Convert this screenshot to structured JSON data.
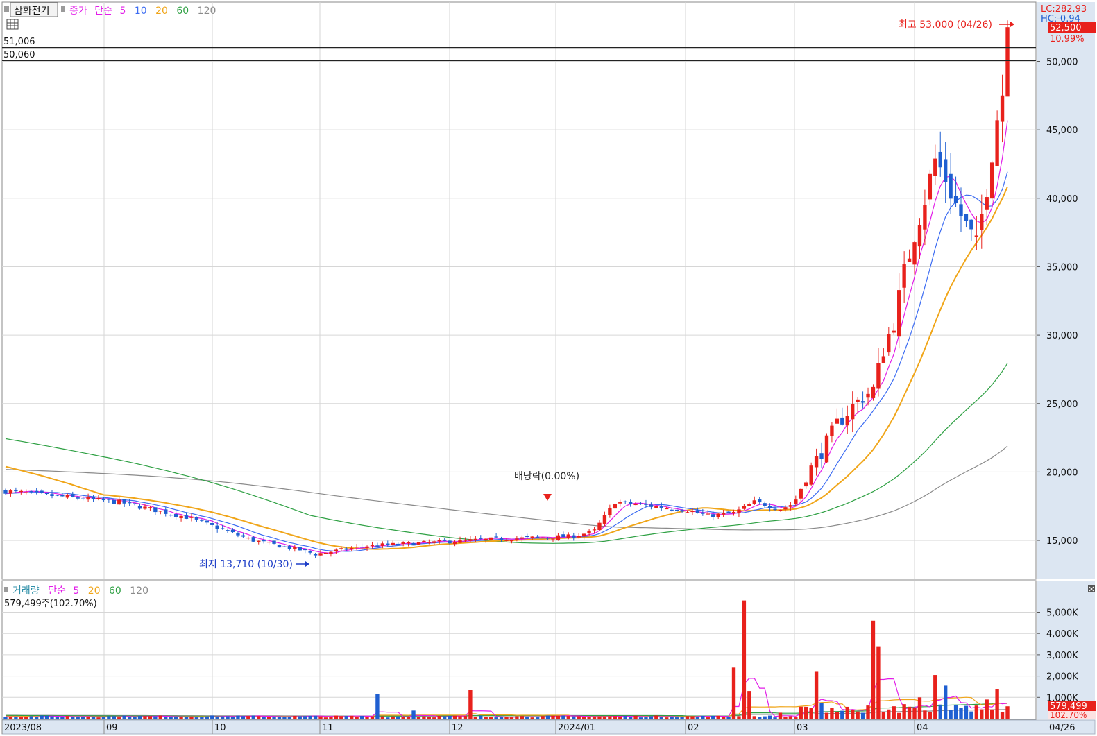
{
  "header": {
    "stock_name": "삼화전기",
    "price_legend": {
      "title": "종가",
      "method": "단순",
      "periods": [
        "5",
        "10",
        "20",
        "60",
        "120"
      ]
    },
    "top_right": {
      "lc": "LC:282.93",
      "hc": "HC:-0.94"
    },
    "level_labels": [
      "51,006",
      "50,060"
    ]
  },
  "price_panel": {
    "y_ticks": [
      "15,000",
      "20,000",
      "25,000",
      "30,000",
      "35,000",
      "40,000",
      "45,000",
      "50,000"
    ],
    "current_price": "52,500",
    "current_change": "10.99%",
    "annotations": {
      "high": "최고 53,000 (04/26)",
      "low": "최저 13,710 (10/30)",
      "dividend": "배당락(0.00%)"
    }
  },
  "volume_panel": {
    "legend": {
      "title": "거래량",
      "method": "단순",
      "periods": [
        "5",
        "20",
        "60",
        "120"
      ]
    },
    "info": "579,499주(102.70%)",
    "y_ticks": [
      "1,000K",
      "2,000K",
      "3,000K",
      "4,000K",
      "5,000K"
    ],
    "current_volume": "579,499",
    "current_ratio": "102.70%"
  },
  "x_axis": {
    "labels": [
      "2023/08",
      "09",
      "10",
      "11",
      "12",
      "2024/01",
      "02",
      "03",
      "04"
    ],
    "end_label": "04/26"
  },
  "colors": {
    "up": "#e8211c",
    "down": "#1f5fd1",
    "ma5": "#e21ce8",
    "ma10": "#3c6cf2",
    "ma20": "#f0a518",
    "ma60": "#2ea043",
    "ma120": "#8a8a8a",
    "grid": "#d6d6d6",
    "axis_bg": "#dce6f2"
  },
  "chart_data": {
    "type": "candlestick",
    "title": "삼화전기",
    "x_range": [
      "2023-08",
      "2024-04-26"
    ],
    "ylim": [
      12500,
      53500
    ],
    "ylim_volume": [
      0,
      5800000
    ],
    "levels": [
      51006,
      50060
    ],
    "high": {
      "value": 53000,
      "date": "2024-04-26"
    },
    "low": {
      "value": 13710,
      "date": "2023-10-30"
    },
    "close_last": 52500,
    "change_last_pct": 10.99,
    "volume_last": 579499,
    "volume_ratio_pct": 102.7,
    "moving_averages_price": [
      "5",
      "10",
      "20",
      "60",
      "120"
    ],
    "moving_averages_volume": [
      "5",
      "20",
      "60",
      "120"
    ],
    "ma_last": {
      "ma5": 45800,
      "ma10": 42600,
      "ma20": 39200,
      "ma60": 26500,
      "ma120": 21300
    }
  }
}
